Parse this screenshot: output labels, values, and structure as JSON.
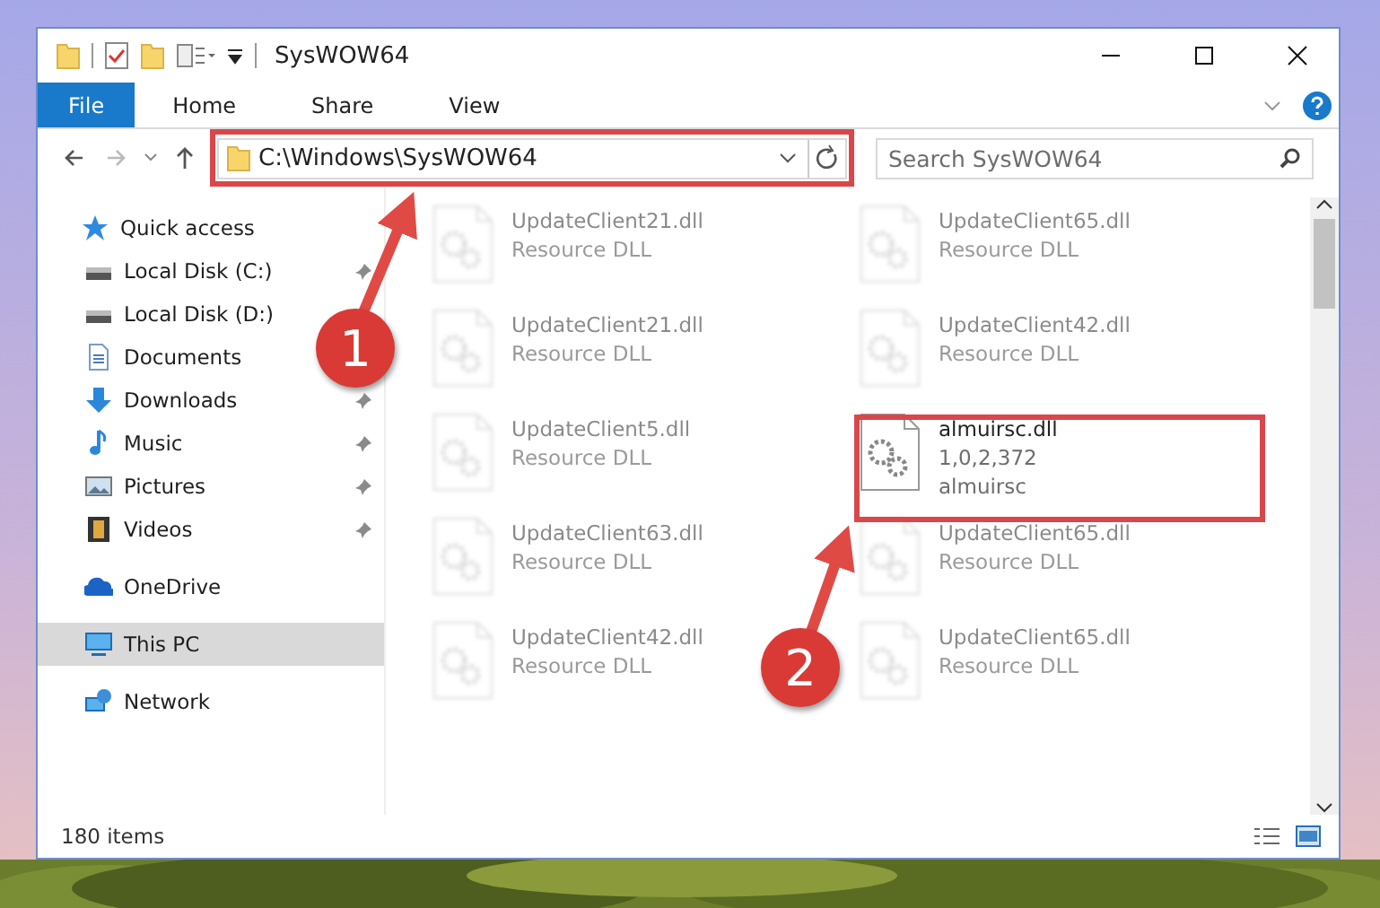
{
  "window": {
    "title": "SysWOW64"
  },
  "ribbon_tabs": [
    {
      "label": "File",
      "kind": "file"
    },
    {
      "label": "Home",
      "kind": "tab"
    },
    {
      "label": "Share",
      "kind": "tab"
    },
    {
      "label": "View",
      "kind": "tab"
    }
  ],
  "address": {
    "path": "C:\\Windows\\SysWOW64"
  },
  "search": {
    "placeholder": "Search SysWOW64"
  },
  "sidebar": {
    "items": [
      {
        "label": "Quick access",
        "kind": "star",
        "selected": false,
        "children": [
          {
            "label": "Local Disk (C:)",
            "kind": "disk",
            "pinned": true,
            "selected": false
          },
          {
            "label": "Local Disk (D:)",
            "kind": "disk",
            "pinned": false,
            "selected": false
          },
          {
            "label": "Documents",
            "kind": "document",
            "pinned": false,
            "selected": false
          },
          {
            "label": "Downloads",
            "kind": "download",
            "pinned": true,
            "selected": false
          },
          {
            "label": "Music",
            "kind": "music",
            "pinned": true,
            "selected": false
          },
          {
            "label": "Pictures",
            "kind": "pictures",
            "pinned": true,
            "selected": false
          },
          {
            "label": "Videos",
            "kind": "videos",
            "pinned": true,
            "selected": false
          }
        ]
      },
      {
        "label": "OneDrive",
        "kind": "cloud",
        "selected": false
      },
      {
        "label": "This PC",
        "kind": "pc",
        "selected": true
      },
      {
        "label": "Network",
        "kind": "network",
        "selected": false
      }
    ]
  },
  "files": [
    {
      "name": "UpdateClient21.dll",
      "details": [
        "Resource DLL"
      ],
      "faded": true
    },
    {
      "name": "UpdateClient65.dll",
      "details": [
        "Resource DLL"
      ],
      "faded": true
    },
    {
      "name": "UpdateClient21.dll",
      "details": [
        "Resource DLL"
      ],
      "faded": true
    },
    {
      "name": "UpdateClient42.dll",
      "details": [
        "Resource DLL"
      ],
      "faded": true
    },
    {
      "name": "UpdateClient5.dll",
      "details": [
        "Resource DLL"
      ],
      "faded": true
    },
    {
      "name": "almuirsc.dll",
      "details": [
        "1,0,2,372",
        "almuirsc"
      ],
      "faded": false
    },
    {
      "name": "UpdateClient63.dll",
      "details": [
        "Resource DLL"
      ],
      "faded": true
    },
    {
      "name": "UpdateClient65.dll",
      "details": [
        "Resource DLL"
      ],
      "faded": true
    },
    {
      "name": "UpdateClient42.dll",
      "details": [
        "Resource DLL"
      ],
      "faded": true
    },
    {
      "name": "UpdateClient65.dll",
      "details": [
        "Resource DLL"
      ],
      "faded": true
    }
  ],
  "status_bar": {
    "count": "180 items"
  },
  "annotations": [
    {
      "label": "1"
    },
    {
      "label": "2"
    }
  ]
}
